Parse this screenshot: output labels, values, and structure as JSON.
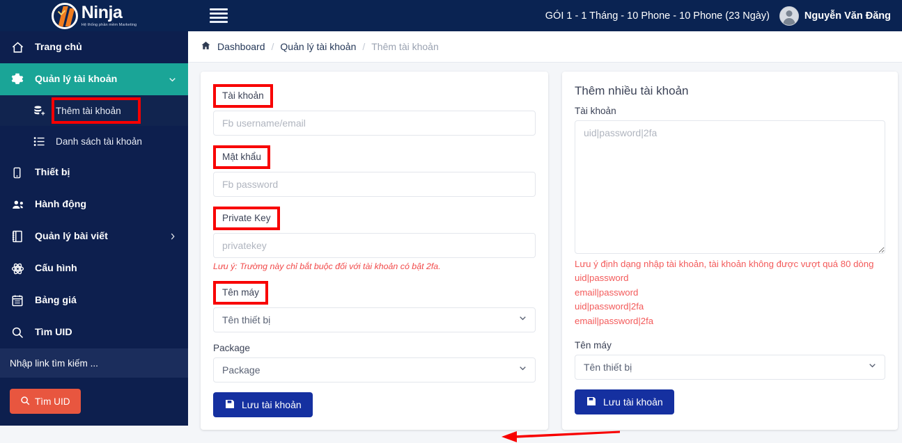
{
  "header": {
    "logo_name": "Ninja",
    "logo_tagline": "Hệ thống phần mềm Marketing",
    "menu_icon": "hamburger-icon",
    "package_info": "GÓI 1 - 1 Tháng - 10 Phone - 10 Phone (23 Ngày)",
    "user_name": "Nguyễn Văn Đăng"
  },
  "sidebar": {
    "items": [
      {
        "label": "Trang chủ",
        "icon": "home-icon",
        "active": false,
        "has_caret": false
      },
      {
        "label": "Quản lý tài khoản",
        "icon": "gear-icon",
        "active": true,
        "has_caret": true
      },
      {
        "label": "Thiết bị",
        "icon": "mobile-icon",
        "active": false,
        "has_caret": false
      },
      {
        "label": "Hành động",
        "icon": "users-icon",
        "active": false,
        "has_caret": false
      },
      {
        "label": "Quản lý bài viết",
        "icon": "book-icon",
        "active": false,
        "has_caret": true
      },
      {
        "label": "Cấu hình",
        "icon": "atom-icon",
        "active": false,
        "has_caret": false
      },
      {
        "label": "Bảng giá",
        "icon": "calendar-icon",
        "active": false,
        "has_caret": false
      },
      {
        "label": "Tìm UID",
        "icon": "search-icon",
        "active": false,
        "has_caret": false
      }
    ],
    "sub_items": [
      {
        "label": "Thêm tài khoản",
        "icon": "database-add-icon",
        "highlighted": true
      },
      {
        "label": "Danh sách tài khoản",
        "icon": "list-icon",
        "highlighted": false
      }
    ],
    "search_placeholder": "Nhập link tìm kiếm ...",
    "search_value": "",
    "find_uid_button": "Tìm UID"
  },
  "breadcrumb": {
    "home_icon": "home-icon",
    "items": [
      "Dashboard",
      "Quản lý tài khoản",
      "Thêm tài khoản"
    ],
    "separator": "/"
  },
  "left_form": {
    "account_label": "Tài khoản",
    "account_placeholder": "Fb username/email",
    "account_value": "",
    "password_label": "Mật khẩu",
    "password_placeholder": "Fb password",
    "password_value": "",
    "privatekey_label": "Private Key",
    "privatekey_placeholder": "privatekey",
    "privatekey_value": "",
    "privatekey_note": "Lưu ý: Trường này chỉ bắt buộc đối với tài khoản có bật 2fa.",
    "device_label": "Tên máy",
    "device_selected": "Tên thiết bị",
    "package_label": "Package",
    "package_selected": "Package",
    "save_button": "Lưu tài khoản",
    "save_icon": "save-floppy-icon"
  },
  "right_form": {
    "title": "Thêm nhiều tài khoản",
    "account_label": "Tài khoản",
    "textarea_placeholder": "uid|password|2fa",
    "textarea_value": "",
    "format_note": "Lưu ý định dạng nhập tài khoản, tài khoản không được vượt quá 80 dòng",
    "format_lines": [
      "uid|password",
      "email|password",
      "uid|password|2fa",
      "email|password|2fa"
    ],
    "device_label": "Tên máy",
    "device_selected": "Tên thiết bị",
    "save_button": "Lưu tài khoản",
    "save_icon": "save-floppy-icon"
  },
  "annotations": {
    "highlight_color": "#f80000",
    "arrow_color": "#f80000",
    "highlighted_labels": [
      "Tài khoản",
      "Mật khẩu",
      "Private Key",
      "Tên máy",
      "Thêm tài khoản"
    ]
  },
  "colors": {
    "header_bg": "#0a2352",
    "sidebar_bg": "#0d1f4e",
    "sidebar_active": "#1aa597",
    "accent_blue": "#1530a0",
    "accent_orange": "#e8563f",
    "note_red": "#f35a5a"
  }
}
